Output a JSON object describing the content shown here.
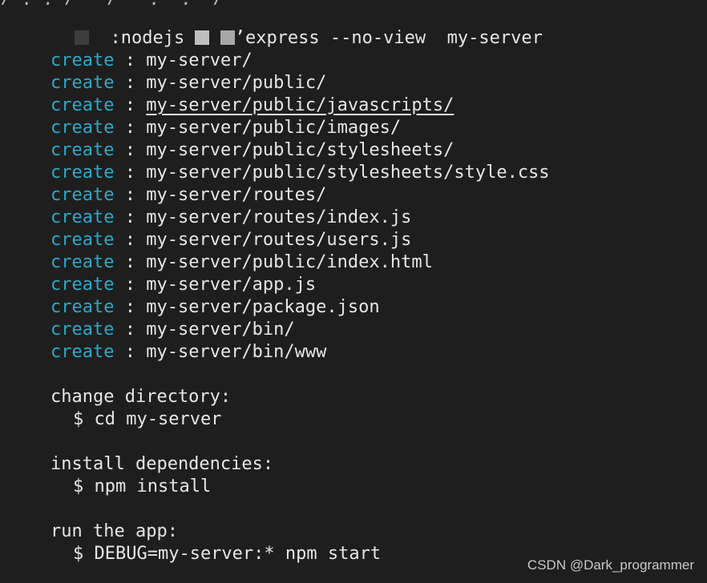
{
  "terminal": {
    "top_cut_text": "/ , , /   /   ,  ,  /",
    "command": {
      "prefix": ":nodejs",
      "suffix": "’express --no-view  my-server"
    },
    "create_keyword": "create",
    "separator": " : ",
    "create_lines": [
      "my-server/",
      "my-server/public/",
      "my-server/public/javascripts/",
      "my-server/public/images/",
      "my-server/public/stylesheets/",
      "my-server/public/stylesheets/style.css",
      "my-server/routes/",
      "my-server/routes/index.js",
      "my-server/routes/users.js",
      "my-server/public/index.html",
      "my-server/app.js",
      "my-server/package.json",
      "my-server/bin/",
      "my-server/bin/www"
    ],
    "instructions": [
      {
        "heading": "change directory:",
        "command": "$ cd my-server"
      },
      {
        "heading": "install dependencies:",
        "command": "$ npm install"
      },
      {
        "heading": "run the app:",
        "command": "$ DEBUG=my-server:* npm start"
      }
    ]
  },
  "watermark": "CSDN @Dark_programmer",
  "colors": {
    "background": "#1e1e1e",
    "keyword": "#2fa8c9",
    "text": "#e6e6e6"
  }
}
